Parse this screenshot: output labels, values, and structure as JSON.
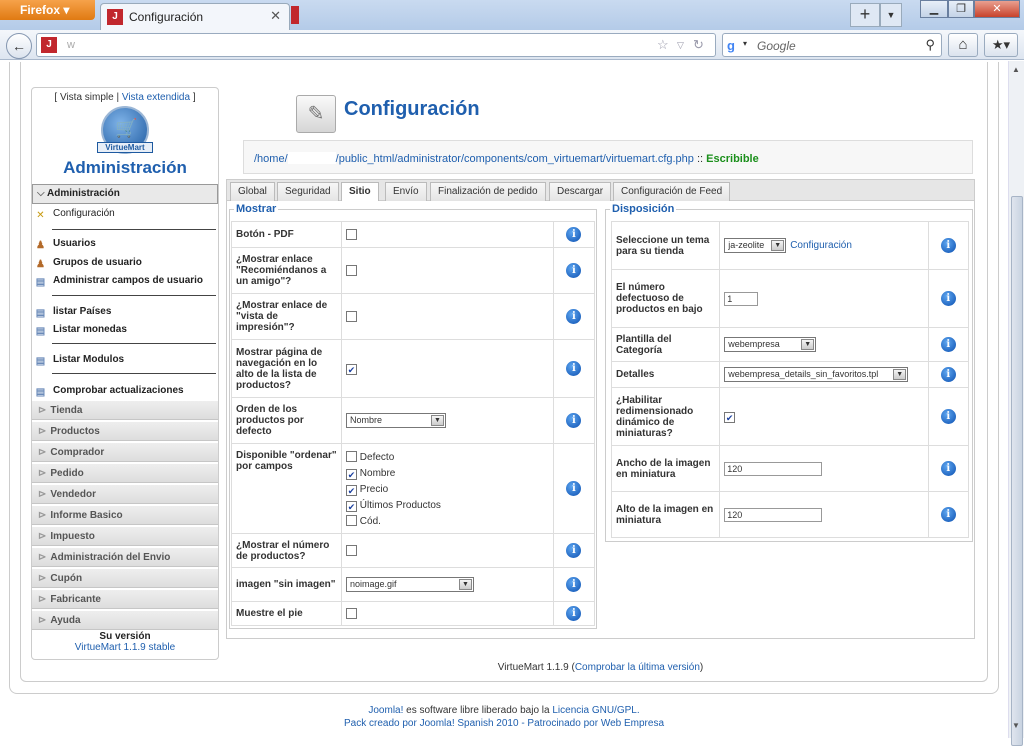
{
  "browser": {
    "app_button": "Firefox",
    "tab_title": "Configuración",
    "url_text": "w",
    "search_placeholder": "Google"
  },
  "sidebar": {
    "vista_simple": "Vista simple",
    "vista_extendida": "Vista extendida",
    "logo_text": "VirtueMart",
    "title": "Administración",
    "menu_header": "Administración",
    "items": [
      {
        "label": "Configuración",
        "icon": "tools-icon"
      },
      {
        "label": "Usuarios",
        "icon": "users-icon"
      },
      {
        "label": "Grupos de usuario",
        "icon": "users-icon"
      },
      {
        "label": "Administrar campos de usuario",
        "icon": "page-icon"
      },
      {
        "label": "listar Países",
        "icon": "page-icon"
      },
      {
        "label": "Listar monedas",
        "icon": "page-icon"
      },
      {
        "label": "Listar Modulos",
        "icon": "page-icon"
      },
      {
        "label": "Comprobar actualizaciones",
        "icon": "page-icon"
      }
    ],
    "categories": [
      "Tienda",
      "Productos",
      "Comprador",
      "Pedido",
      "Vendedor",
      "Informe Basico",
      "Impuesto",
      "Administración del Envio",
      "Cupón",
      "Fabricante",
      "Ayuda"
    ],
    "version_label": "Su versión",
    "version_value": "VirtueMart 1.1.9 stable"
  },
  "content": {
    "title": "Configuración",
    "path_start": "/home/",
    "path_end": "/public_html/administrator/components/com_virtuemart/virtuemart.cfg.php",
    "path_sep": "::",
    "writable": "Escribible",
    "tabs": [
      "Global",
      "Seguridad",
      "Sitio",
      "Envío",
      "Finalización de pedido",
      "Descargar",
      "Configuración de Feed"
    ],
    "active_tab": "Sitio",
    "mostrar": {
      "legend": "Mostrar",
      "boton_pdf": "Botón - PDF",
      "recomendar": "¿Mostrar enlace \"Recomiéndanos a un amigo\"?",
      "impresion": "¿Mostrar enlace de \"vista de impresión\"?",
      "navegacion": "Mostrar página de navegación en lo alto de la lista de productos?",
      "orden_label": "Orden de los productos por defecto",
      "orden_value": "Nombre",
      "ordenar_label": "Disponible \"ordenar\" por campos",
      "ordenar_options": [
        {
          "label": "Defecto",
          "checked": false
        },
        {
          "label": "Nombre",
          "checked": true
        },
        {
          "label": "Precio",
          "checked": true
        },
        {
          "label": "Últimos Productos",
          "checked": true
        },
        {
          "label": "Cód.",
          "checked": false
        }
      ],
      "num_productos": "¿Mostrar el número de productos?",
      "sin_imagen_label": "imagen \"sin imagen\"",
      "sin_imagen_value": "noimage.gif",
      "pie": "Muestre el pie"
    },
    "disposicion": {
      "legend": "Disposición",
      "tema_label": "Seleccione un tema para su tienda",
      "tema_value": "ja-zeolite",
      "tema_link": "Configuración",
      "numero_label": "El número defectuoso de productos en bajo",
      "numero_value": "1",
      "plantilla_label": "Plantilla del Categoría",
      "plantilla_value": "webempresa",
      "detalles_label": "Detalles",
      "detalles_value": "webempresa_details_sin_favoritos.tpl",
      "redim_label": "¿Habilitar redimensionado dinámico de miniaturas?",
      "ancho_label": "Ancho de la imagen en miniatura",
      "ancho_value": "120",
      "alto_label": "Alto de la imagen en miniatura",
      "alto_value": "120"
    },
    "footer_version": "VirtueMart 1.1.9",
    "footer_link": "Comprobar la última versión"
  },
  "footer": {
    "line1_a": "Joomla!",
    "line1_b": "es software libre liberado bajo la",
    "line1_c": "Licencia GNU/GPL.",
    "line2_a": "Pack creado por",
    "line2_b": "Joomla! Spanish 2010 - Patrocinado por",
    "line2_c": "Web Empresa"
  }
}
